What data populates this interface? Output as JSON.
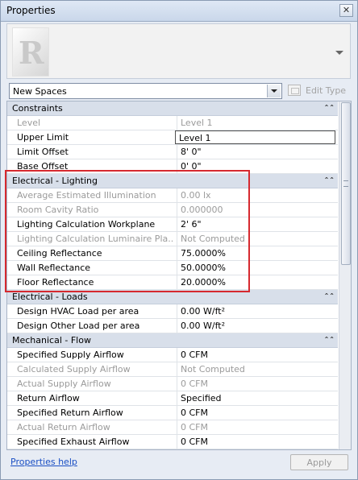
{
  "window": {
    "title": "Properties",
    "close_symbol": "✕"
  },
  "type_selector": {
    "value": "New Spaces",
    "edit_type_label": "Edit Type"
  },
  "categories": [
    {
      "name": "Constraints",
      "rows": [
        {
          "name": "Level",
          "value": "Level 1",
          "readonly": true
        },
        {
          "name": "Upper Limit",
          "value": "Level 1",
          "readonly": false,
          "active": true
        },
        {
          "name": "Limit Offset",
          "value": "8'  0\"",
          "readonly": false
        },
        {
          "name": "Base Offset",
          "value": "0'  0\"",
          "readonly": false
        }
      ]
    },
    {
      "name": "Electrical - Lighting",
      "rows": [
        {
          "name": "Average Estimated Illumination",
          "value": "0.00 lx",
          "readonly": true
        },
        {
          "name": "Room Cavity Ratio",
          "value": "0.000000",
          "readonly": true
        },
        {
          "name": "Lighting Calculation Workplane",
          "value": "2'  6\"",
          "readonly": false
        },
        {
          "name": "Lighting Calculation Luminaire Pla...",
          "value": "Not Computed",
          "readonly": true
        },
        {
          "name": "Ceiling Reflectance",
          "value": "75.0000%",
          "readonly": false
        },
        {
          "name": "Wall Reflectance",
          "value": "50.0000%",
          "readonly": false
        },
        {
          "name": "Floor Reflectance",
          "value": "20.0000%",
          "readonly": false
        }
      ]
    },
    {
      "name": "Electrical - Loads",
      "rows": [
        {
          "name": "Design HVAC Load per area",
          "value": "0.00 W/ft²",
          "readonly": false
        },
        {
          "name": "Design Other Load per area",
          "value": "0.00 W/ft²",
          "readonly": false
        }
      ]
    },
    {
      "name": "Mechanical - Flow",
      "rows": [
        {
          "name": "Specified Supply Airflow",
          "value": "0 CFM",
          "readonly": false
        },
        {
          "name": "Calculated Supply Airflow",
          "value": "Not Computed",
          "readonly": true
        },
        {
          "name": "Actual Supply Airflow",
          "value": "0 CFM",
          "readonly": true
        },
        {
          "name": "Return Airflow",
          "value": "Specified",
          "readonly": false
        },
        {
          "name": "Specified Return Airflow",
          "value": "0 CFM",
          "readonly": false
        },
        {
          "name": "Actual Return Airflow",
          "value": "0 CFM",
          "readonly": true
        },
        {
          "name": "Specified Exhaust Airflow",
          "value": "0 CFM",
          "readonly": false
        }
      ]
    }
  ],
  "footer": {
    "help_link": "Properties help",
    "apply_label": "Apply"
  },
  "colors": {
    "highlight": "#d6292f",
    "category_bg": "#d8dfea",
    "link": "#1a4fc4"
  }
}
